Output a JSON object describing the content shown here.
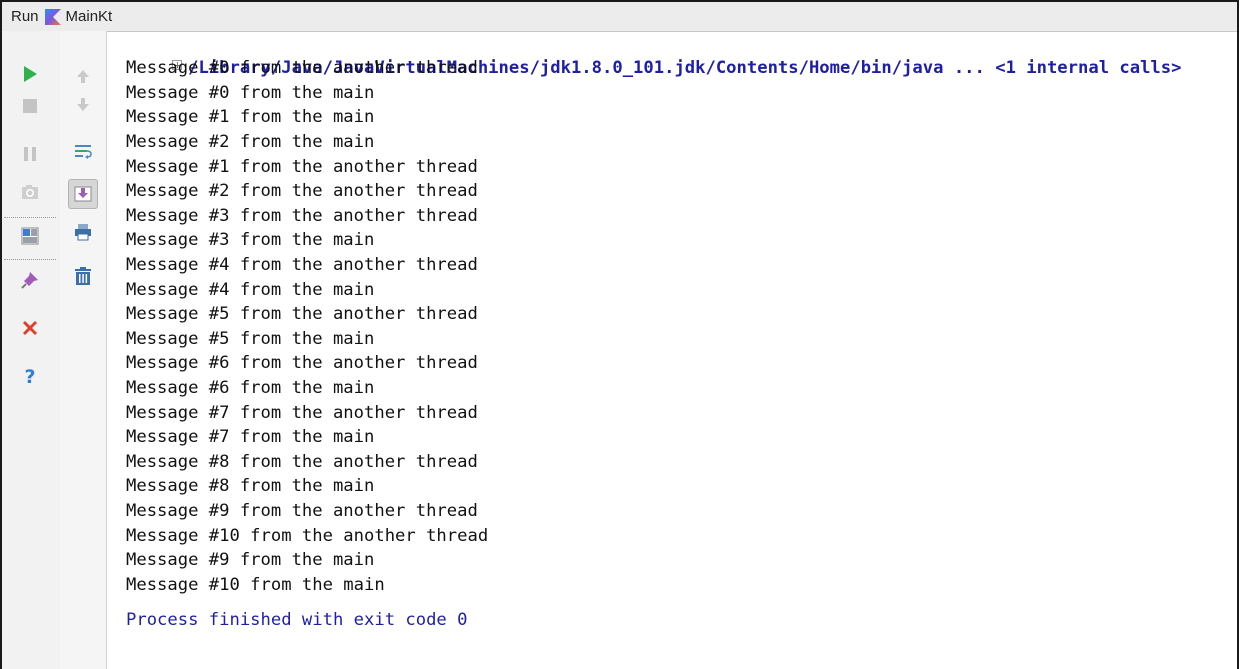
{
  "header": {
    "run_label": "Run",
    "config_name": "MainKt"
  },
  "toolbar_left": [
    {
      "name": "rerun-icon",
      "color": "#2fb24b"
    },
    {
      "name": "stop-icon",
      "color": "#bdbdbd"
    },
    {
      "name": "pause-icon",
      "color": "#bdbdbd"
    },
    {
      "name": "camera-icon",
      "color": "#bdbdbd"
    },
    {
      "name": "restore-layout-icon",
      "color": "#3c7bd6"
    },
    {
      "name": "pin-icon",
      "color": "#a45ab8"
    },
    {
      "name": "close-icon",
      "color": "#e0402a"
    },
    {
      "name": "help-icon",
      "color": "#2f7fd8"
    }
  ],
  "toolbar_right": [
    {
      "name": "up-arrow-icon"
    },
    {
      "name": "down-arrow-icon"
    },
    {
      "name": "soft-wrap-icon"
    },
    {
      "name": "scroll-to-end-icon"
    },
    {
      "name": "print-icon"
    },
    {
      "name": "trash-icon"
    }
  ],
  "console": {
    "command": "/Library/Java/JavaVirtualMachines/jdk1.8.0_101.jdk/Contents/Home/bin/java ... <1 internal calls>",
    "lines": [
      "Message #0 from the another thread",
      "Message #0 from the main",
      "Message #1 from the main",
      "Message #2 from the main",
      "Message #1 from the another thread",
      "Message #2 from the another thread",
      "Message #3 from the another thread",
      "Message #3 from the main",
      "Message #4 from the another thread",
      "Message #4 from the main",
      "Message #5 from the another thread",
      "Message #5 from the main",
      "Message #6 from the another thread",
      "Message #6 from the main",
      "Message #7 from the another thread",
      "Message #7 from the main",
      "Message #8 from the another thread",
      "Message #8 from the main",
      "Message #9 from the another thread",
      "Message #10 from the another thread",
      "Message #9 from the main",
      "Message #10 from the main"
    ],
    "exit_message": "Process finished with exit code 0"
  }
}
